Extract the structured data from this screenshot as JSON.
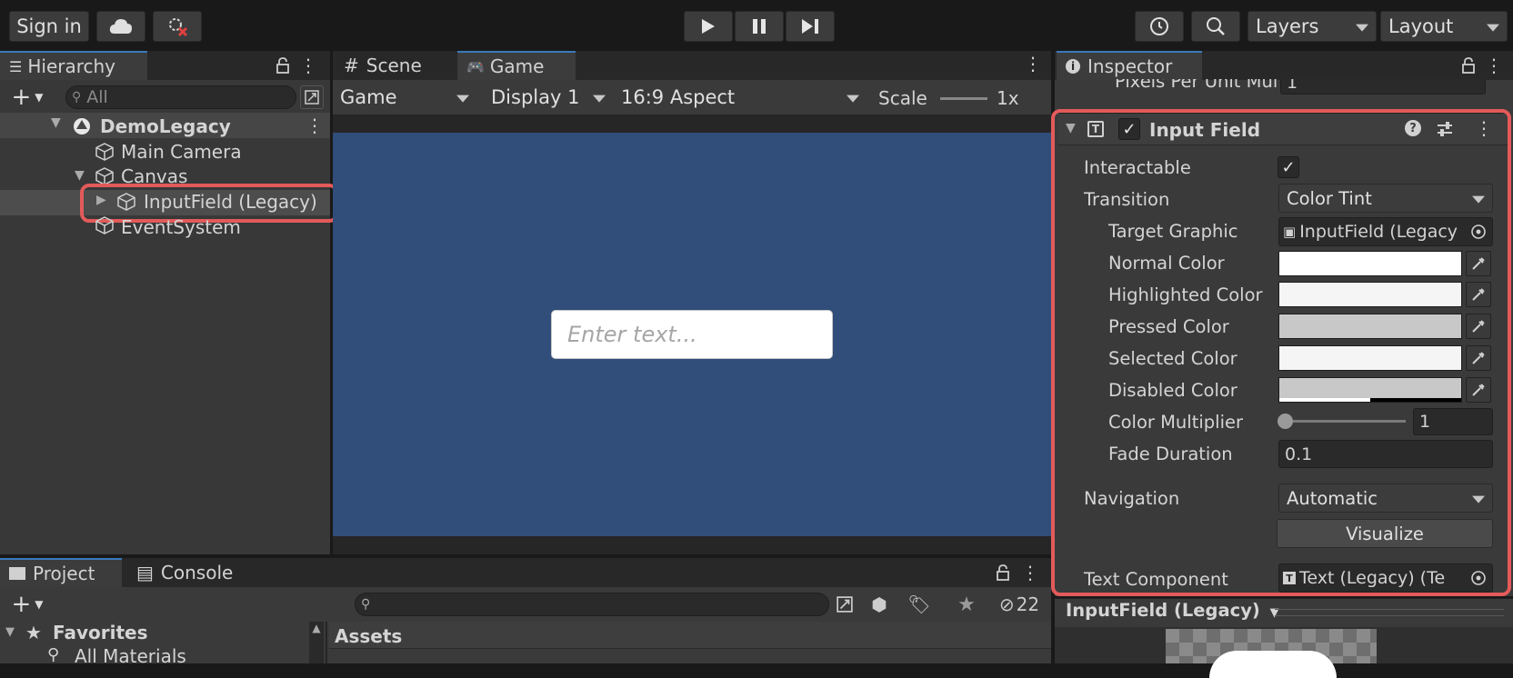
{
  "toolbar": {
    "sign_in": "Sign in",
    "play_icon": "play-icon",
    "pause_icon": "pause-icon",
    "step_icon": "step-icon",
    "layers": "Layers",
    "layout": "Layout"
  },
  "hierarchy": {
    "tab": "Hierarchy",
    "search_placeholder": "All",
    "scene": "DemoLegacy",
    "items": [
      "Main Camera",
      "Canvas",
      "InputField (Legacy)",
      "EventSystem"
    ]
  },
  "game": {
    "tabs": [
      "Scene",
      "Game"
    ],
    "mode": "Game",
    "display": "Display 1",
    "aspect": "16:9 Aspect",
    "scale_label": "Scale",
    "scale_value": "1x",
    "input_placeholder": "Enter text..."
  },
  "inspector": {
    "tab": "Inspector",
    "prev_row": "Pixels Per Unit Mul",
    "prev_value": "1",
    "component": "Input Field",
    "interactable_label": "Interactable",
    "transition_label": "Transition",
    "transition_value": "Color Tint",
    "target_graphic_label": "Target Graphic",
    "target_graphic_value": "InputField (Legacy",
    "normal_color_label": "Normal Color",
    "highlighted_color_label": "Highlighted Color",
    "pressed_color_label": "Pressed Color",
    "selected_color_label": "Selected Color",
    "disabled_color_label": "Disabled Color",
    "color_multiplier_label": "Color Multiplier",
    "color_multiplier_value": "1",
    "fade_duration_label": "Fade Duration",
    "fade_duration_value": "0.1",
    "navigation_label": "Navigation",
    "navigation_value": "Automatic",
    "visualize": "Visualize",
    "text_component_label": "Text Component",
    "text_component_value": "Text (Legacy) (Te",
    "preview_title": "InputField (Legacy)"
  },
  "project": {
    "tabs": [
      "Project",
      "Console"
    ],
    "favorites": "Favorites",
    "fav_item": "All Materials",
    "assets": "Assets",
    "hidden_count": "22"
  },
  "colors": {
    "normal": "#ffffff",
    "highlighted": "#f5f5f5",
    "pressed": "#c8c8c8",
    "selected": "#f5f5f5",
    "disabled": "#c8c8c8",
    "game_bg": "#314d79",
    "highlight": "#e35a5a"
  }
}
